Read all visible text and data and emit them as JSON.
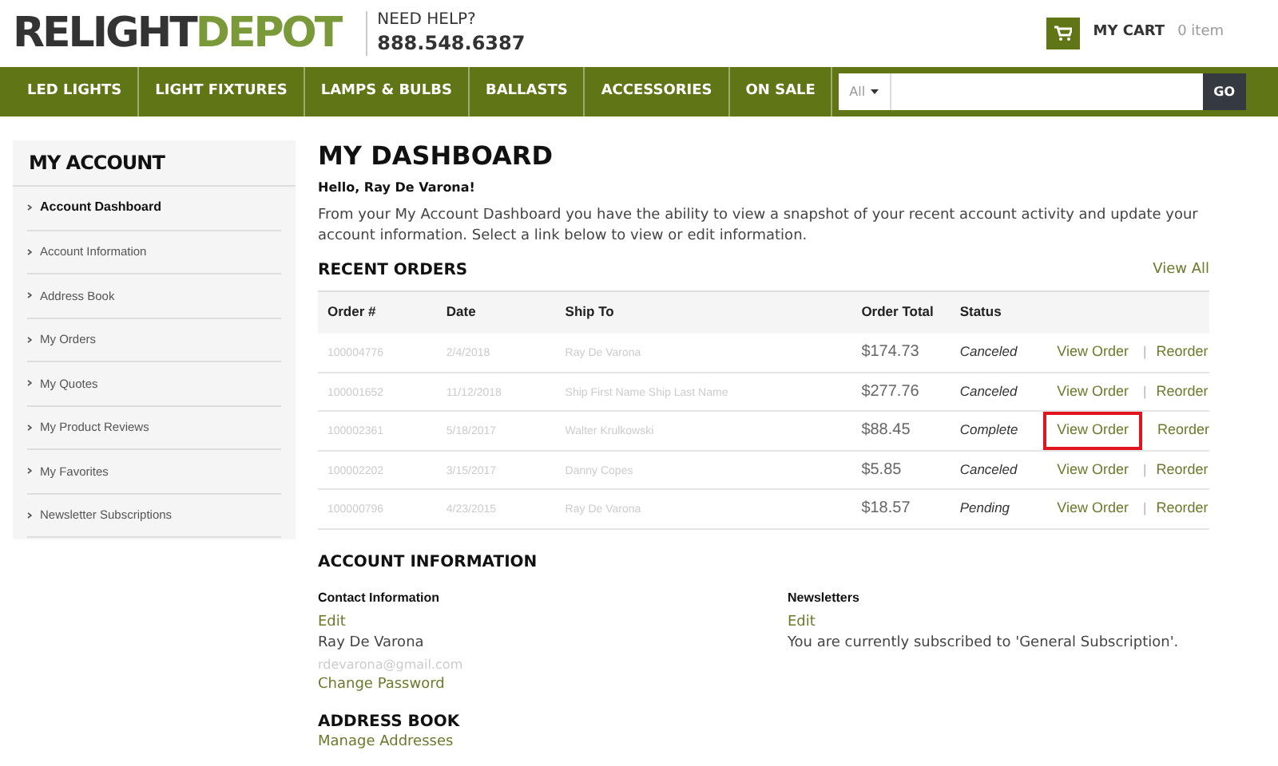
{
  "logo": {
    "part_1": "RELIGHT",
    "part_2": "DEPOT"
  },
  "help": {
    "label": "NEED HELP?",
    "phone": "888.548.6387"
  },
  "cart": {
    "label": "MY CART",
    "count": "0 item"
  },
  "nav": [
    "LED LIGHTS",
    "LIGHT FIXTURES",
    "LAMPS & BULBS",
    "BALLASTS",
    "ACCESSORIES",
    "ON SALE"
  ],
  "search": {
    "category": "All",
    "button": "GO"
  },
  "sidebar": {
    "title": "MY ACCOUNT",
    "items": [
      {
        "label": "Account Dashboard",
        "selected": true
      },
      {
        "label": "Account Information",
        "selected": false
      },
      {
        "label": "Address Book",
        "selected": false
      },
      {
        "label": "My Orders",
        "selected": false
      },
      {
        "label": "My Quotes",
        "selected": false
      },
      {
        "label": "My Product Reviews",
        "selected": false
      },
      {
        "label": "My Favorites",
        "selected": false
      },
      {
        "label": "Newsletter Subscriptions",
        "selected": false
      }
    ]
  },
  "page_title": "MY DASHBOARD",
  "greeting": "Hello, Ray De Varona!",
  "intro": "From your My Account Dashboard you have the ability to view a snapshot of your recent account activity and update your account information. Select a link below to view or edit information.",
  "recent_orders": {
    "title": "RECENT ORDERS",
    "view_all": "View All",
    "columns": [
      "Order #",
      "Date",
      "Ship To",
      "Order Total",
      "Status"
    ],
    "rows": [
      {
        "order": "100004776",
        "date": "2/4/2018",
        "ship_to": "Ray De Varona",
        "total": "$174.73",
        "status": "Canceled",
        "view": "View Order",
        "separator": "|",
        "reorder": "Reorder",
        "highlighted": false
      },
      {
        "order": "100001652",
        "date": "11/12/2018",
        "ship_to": "Ship First Name Ship Last Name",
        "total": "$277.76",
        "status": "Canceled",
        "view": "View Order",
        "separator": "|",
        "reorder": "Reorder",
        "highlighted": false
      },
      {
        "order": "100002361",
        "date": "5/18/2017",
        "ship_to": "Walter Krulkowski",
        "total": "$88.45",
        "status": "Complete",
        "view": "View Order",
        "reorder": "Reorder",
        "highlighted": true
      },
      {
        "order": "100002202",
        "date": "3/15/2017",
        "ship_to": "Danny Copes",
        "total": "$5.85",
        "status": "Canceled",
        "view": "View Order",
        "separator": "|",
        "reorder": "Reorder",
        "highlighted": false
      },
      {
        "order": "100000796",
        "date": "4/23/2015",
        "ship_to": "Ray De Varona",
        "total": "$18.57",
        "status": "Pending",
        "view": "View Order",
        "separator": "|",
        "reorder": "Reorder",
        "highlighted": false
      }
    ]
  },
  "account_information": {
    "title": "ACCOUNT INFORMATION",
    "contact": {
      "title": "Contact Information",
      "edit": "Edit",
      "name": "Ray De Varona",
      "email": "rdevarona@gmail.com",
      "change_password": "Change Password"
    },
    "newsletters": {
      "title": "Newsletters",
      "edit": "Edit",
      "text": "You are currently subscribed to 'General Subscription'."
    }
  },
  "address_book": {
    "title": "ADDRESS BOOK",
    "link": "Manage Addresses"
  }
}
